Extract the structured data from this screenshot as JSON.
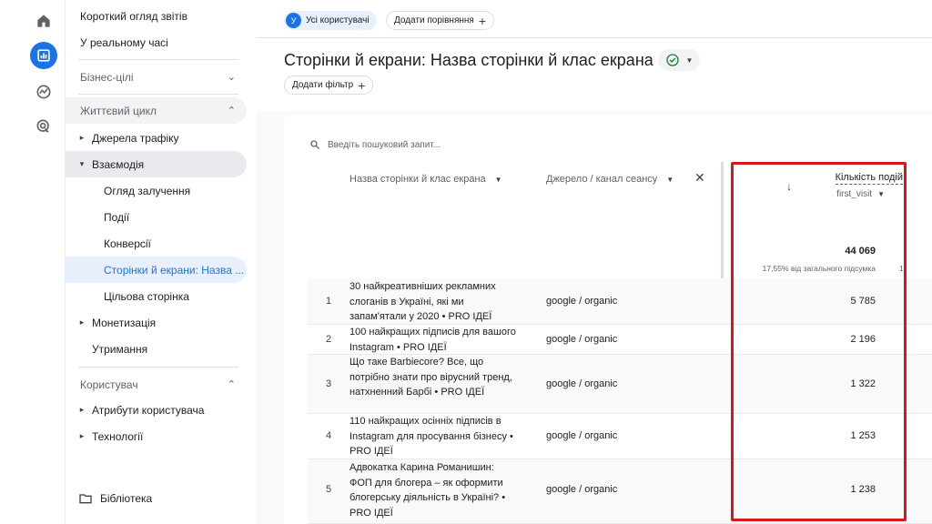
{
  "rail": {
    "icons": [
      "home-icon",
      "reports-icon",
      "explore-icon",
      "advertising-icon"
    ],
    "active_color": "#1a73e8"
  },
  "sidebar": {
    "reports_snapshot": "Короткий огляд звітів",
    "realtime": "У реальному часі",
    "business_goals": "Бізнес-цілі",
    "lifecycle": "Життєвий цикл",
    "traffic_sources": "Джерела трафіку",
    "engagement": "Взаємодія",
    "engagement_overview": "Огляд залучення",
    "events": "Події",
    "conversions": "Конверсії",
    "pages_screens": "Сторінки й екрани: Назва ...",
    "landing_page": "Цільова сторінка",
    "monetization": "Монетизація",
    "retention": "Утримання",
    "user": "Користувач",
    "user_attributes": "Атрибути користувача",
    "tech": "Технології",
    "library": "Бібліотека"
  },
  "topbar": {
    "avatar_letter": "У",
    "all_users": "Усі користувачі",
    "add_comparison": "Додати порівняння"
  },
  "page": {
    "title": "Сторінки й екрани: Назва сторінки й клас екрана",
    "add_filter": "Додати фільтр"
  },
  "table": {
    "search_placeholder": "Введіть пошуковий запит...",
    "dim1": "Назва сторінки й клас екрана",
    "dim2": "Джерело / канал сеансу",
    "metric": "Кількість подій",
    "metric_filter": "first_visit",
    "total": "44 069",
    "total_pct": "17,55% від загального підсумка",
    "next_col_fragment": "1",
    "rows": [
      {
        "idx": "1",
        "title": "30 найкреативніших рекламних слоганів в Україні, які ми запам'ятали у 2020 • PRO ІДЕЇ",
        "src": "google / organic",
        "val": "5 785"
      },
      {
        "idx": "2",
        "title": "100 найкращих підписів для вашого Instagram • PRO ІДЕЇ",
        "src": "google / organic",
        "val": "2 196"
      },
      {
        "idx": "3",
        "title": "Що таке Barbiecore? Все, що потрібно знати про вірусний тренд, натхненний Барбі • PRO ІДЕЇ",
        "src": "google / organic",
        "val": "1 322"
      },
      {
        "idx": "4",
        "title": "110 найкращих осінніх підписів в Instagram для просування бізнесу • PRO ІДЕЇ",
        "src": "google / organic",
        "val": "1 253"
      },
      {
        "idx": "5",
        "title": "Адвокатка Карина Романишин: ФОП для блогера – як оформити блогерську діяльність в Україні? • PRO ІДЕЇ",
        "src": "google / organic",
        "val": "1 238"
      }
    ]
  },
  "highlight_color": "#d9161c"
}
